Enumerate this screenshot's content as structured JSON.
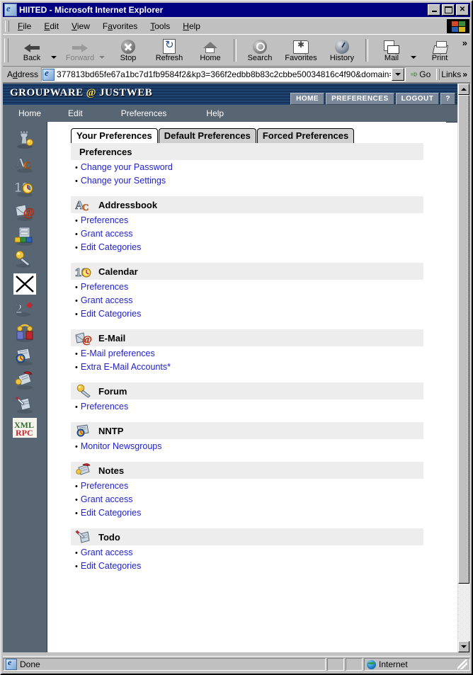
{
  "window": {
    "title": "HIITED - Microsoft Internet Explorer",
    "icon": "ie-document-icon",
    "buttons": {
      "minimize": "_",
      "maximize": "□",
      "close": "✕"
    }
  },
  "menubar": {
    "items": [
      {
        "label": "File"
      },
      {
        "label": "Edit"
      },
      {
        "label": "View"
      },
      {
        "label": "Favorites"
      },
      {
        "label": "Tools"
      },
      {
        "label": "Help"
      }
    ]
  },
  "toolbar": {
    "buttons": [
      {
        "label": "Back",
        "icon": "back-arrow-icon",
        "disabled": false,
        "dropdown": true
      },
      {
        "label": "Forward",
        "icon": "forward-arrow-icon",
        "disabled": true,
        "dropdown": true
      },
      {
        "label": "Stop",
        "icon": "stop-icon",
        "disabled": false,
        "dropdown": false
      },
      {
        "label": "Refresh",
        "icon": "refresh-icon",
        "disabled": false,
        "dropdown": false
      },
      {
        "label": "Home",
        "icon": "home-icon",
        "disabled": false,
        "dropdown": false
      },
      {
        "label": "Search",
        "icon": "search-icon",
        "disabled": false,
        "dropdown": false
      },
      {
        "label": "Favorites",
        "icon": "favorites-icon",
        "disabled": false,
        "dropdown": false
      },
      {
        "label": "History",
        "icon": "history-icon",
        "disabled": false,
        "dropdown": false
      },
      {
        "label": "Mail",
        "icon": "mail-icon",
        "disabled": false,
        "dropdown": true
      },
      {
        "label": "Print",
        "icon": "print-icon",
        "disabled": false,
        "dropdown": false
      }
    ],
    "overflow": "»"
  },
  "address": {
    "label": "Address",
    "value": "377813bd65fe67a1bc7d1fb9584f2&kp3=366f2edbb8b83c2cbbe50034816c4f90&domain=default",
    "placeholder": "",
    "go_label": "Go",
    "go_icon": "go-arrow-icon",
    "links_label": "Links",
    "links_chevron": "»"
  },
  "groupware": {
    "logo_left": "GROUPWARE",
    "logo_at": "@",
    "logo_right": "JUSTWEB",
    "nav": [
      {
        "label": "HOME"
      },
      {
        "label": "PREFERENCES"
      },
      {
        "label": "LOGOUT"
      },
      {
        "label": "?"
      }
    ],
    "menu": [
      {
        "label": "Home"
      },
      {
        "label": "Edit"
      },
      {
        "label": "Preferences"
      },
      {
        "label": "Help"
      }
    ],
    "sidebar": {
      "items": [
        {
          "name": "admin-icon",
          "title": "Administration"
        },
        {
          "name": "addressbook-icon",
          "title": "Addressbook"
        },
        {
          "name": "calendar-icon",
          "title": "Calendar"
        },
        {
          "name": "email-icon",
          "title": "E-Mail"
        },
        {
          "name": "filemanager-icon",
          "title": "Filemanager"
        },
        {
          "name": "forum-icon",
          "title": "Forum"
        },
        {
          "name": "close-x-icon",
          "title": "Close"
        },
        {
          "name": "registration-icon",
          "title": "Registration"
        },
        {
          "name": "projects-icon",
          "title": "Projects"
        },
        {
          "name": "nntp-icon",
          "title": "NNTP"
        },
        {
          "name": "notes-icon",
          "title": "Notes"
        },
        {
          "name": "todo-icon",
          "title": "Todo"
        },
        {
          "name": "xmlrpc-icon",
          "title": "XML-RPC"
        }
      ]
    }
  },
  "tabs": [
    {
      "label": "Your Preferences",
      "active": true
    },
    {
      "label": "Default Preferences",
      "active": false
    },
    {
      "label": "Forced Preferences",
      "active": false
    }
  ],
  "sections": [
    {
      "title": "Preferences",
      "icon": "",
      "links": [
        {
          "label": "Change your Password"
        },
        {
          "label": "Change your Settings"
        }
      ]
    },
    {
      "title": "Addressbook",
      "icon": "addressbook-icon",
      "links": [
        {
          "label": "Preferences"
        },
        {
          "label": "Grant access"
        },
        {
          "label": "Edit Categories"
        }
      ]
    },
    {
      "title": "Calendar",
      "icon": "calendar-icon",
      "links": [
        {
          "label": "Preferences"
        },
        {
          "label": "Grant access"
        },
        {
          "label": "Edit Categories"
        }
      ]
    },
    {
      "title": "E-Mail",
      "icon": "email-icon",
      "links": [
        {
          "label": "E-Mail preferences"
        },
        {
          "label": "Extra E-Mail Accounts*"
        }
      ]
    },
    {
      "title": "Forum",
      "icon": "forum-icon",
      "links": [
        {
          "label": "Preferences"
        }
      ]
    },
    {
      "title": "NNTP",
      "icon": "nntp-icon",
      "links": [
        {
          "label": "Monitor Newsgroups"
        }
      ]
    },
    {
      "title": "Notes",
      "icon": "notes-icon",
      "links": [
        {
          "label": "Preferences"
        },
        {
          "label": "Grant access"
        },
        {
          "label": "Edit Categories"
        }
      ]
    },
    {
      "title": "Todo",
      "icon": "todo-icon",
      "links": [
        {
          "label": "Grant access"
        },
        {
          "label": "Edit Categories"
        }
      ]
    }
  ],
  "bullet": "•",
  "statusbar": {
    "status": "Done",
    "status_icon": "ie-document-icon",
    "zone": "Internet",
    "zone_icon": "globe-icon"
  },
  "colors": {
    "titlebar": "#000080",
    "chrome": "#c0c0c0",
    "gw_header": "#1f4470",
    "gw_sidebar": "#586674",
    "gw_navbtn": "#7a8899",
    "section_head": "#ededed",
    "link": "#2222cc",
    "logo_at": "#ffe14d"
  }
}
